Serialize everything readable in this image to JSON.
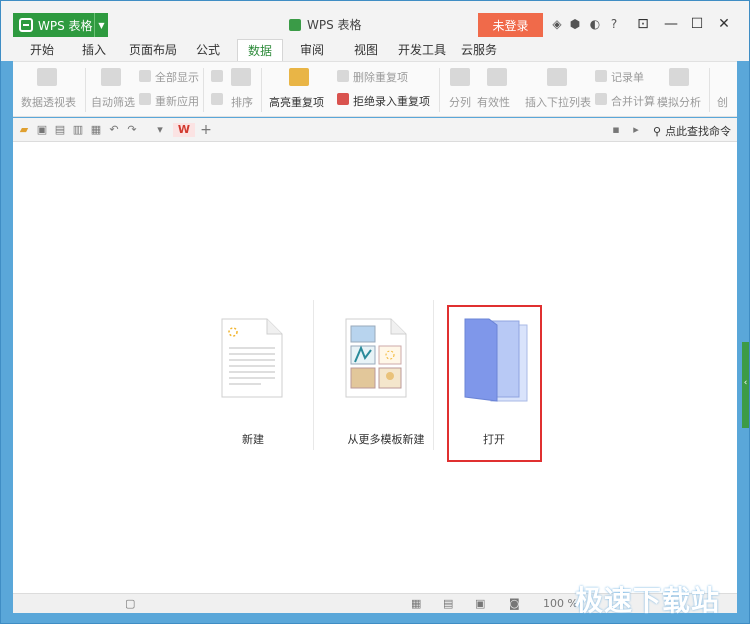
{
  "app": {
    "menu_label": "WPS 表格",
    "title": "WPS 表格",
    "login_label": "未登录",
    "help_label": "?"
  },
  "tabs": [
    {
      "label": "开始"
    },
    {
      "label": "插入"
    },
    {
      "label": "页面布局"
    },
    {
      "label": "公式"
    },
    {
      "label": "数据"
    },
    {
      "label": "审阅"
    },
    {
      "label": "视图"
    },
    {
      "label": "开发工具"
    },
    {
      "label": "云服务"
    }
  ],
  "active_tab": "数据",
  "ribbon": {
    "pivot": "数据透视表",
    "autofilter": "自动筛选",
    "show_all": "全部显示",
    "reapply": "重新应用",
    "sort": "排序",
    "highlight_dup": "高亮重复项",
    "delete_dup": "删除重复项",
    "reject_dup": "拒绝录入重复项",
    "split": "分列",
    "validity": "有效性",
    "insert_dropdown": "插入下拉列表",
    "record_sheet": "记录单",
    "merge_calc": "合并计算",
    "simulate": "模拟分析",
    "create_cut": "创"
  },
  "quick_access": {
    "search_cmd": "点此查找命令"
  },
  "main": {
    "new_label": "新建",
    "template_label": "从更多模板新建",
    "open_label": "打开"
  },
  "status": {
    "zoom": "100 %"
  },
  "watermark": "极速下载站",
  "colors": {
    "accent_green": "#2e9a3f",
    "login_red": "#f06a4a",
    "frame_blue": "#5aa7d9",
    "highlight_red": "#e03030"
  }
}
